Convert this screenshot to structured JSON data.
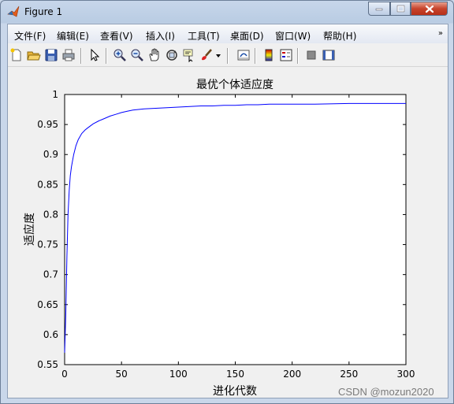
{
  "window": {
    "title": "Figure 1"
  },
  "menu": [
    "文件(F)",
    "编辑(E)",
    "查看(V)",
    "插入(I)",
    "工具(T)",
    "桌面(D)",
    "窗口(W)",
    "帮助(H)"
  ],
  "menu_overflow": "»",
  "toolbar": {
    "icons": [
      "new-figure-icon",
      "open-file-icon",
      "save-icon",
      "print-icon",
      "pointer-icon",
      "zoom-in-icon",
      "zoom-out-icon",
      "pan-icon",
      "rotate-3d-icon",
      "data-cursor-icon",
      "brush-icon",
      "brush-dropdown-icon",
      "link-plot-icon",
      "colorbar-icon",
      "legend-icon",
      "hide-plot-tools-icon",
      "show-plot-tools-icon"
    ]
  },
  "chart_data": {
    "type": "line",
    "title": "最优个体适应度",
    "xlabel": "进化代数",
    "ylabel": "适应度",
    "xlim": [
      0,
      300
    ],
    "ylim": [
      0.55,
      1
    ],
    "xticks": [
      "0",
      "50",
      "100",
      "150",
      "200",
      "250",
      "300"
    ],
    "yticks": [
      "0.55",
      "0.6",
      "0.65",
      "0.7",
      "0.75",
      "0.8",
      "0.85",
      "0.9",
      "0.95",
      "1"
    ],
    "grid": false,
    "series": [
      {
        "color": "#0000ff",
        "x": [
          0,
          1,
          2,
          3,
          4,
          5,
          6,
          8,
          10,
          12,
          15,
          18,
          20,
          25,
          30,
          35,
          40,
          45,
          50,
          55,
          60,
          70,
          80,
          90,
          100,
          110,
          120,
          130,
          140,
          150,
          160,
          170,
          180,
          200,
          220,
          250,
          280,
          300
        ],
        "y": [
          0.57,
          0.63,
          0.73,
          0.8,
          0.84,
          0.865,
          0.88,
          0.9,
          0.915,
          0.925,
          0.935,
          0.941,
          0.944,
          0.951,
          0.956,
          0.96,
          0.964,
          0.967,
          0.97,
          0.972,
          0.974,
          0.976,
          0.977,
          0.978,
          0.979,
          0.98,
          0.981,
          0.981,
          0.982,
          0.982,
          0.983,
          0.983,
          0.984,
          0.984,
          0.984,
          0.985,
          0.985,
          0.985
        ]
      }
    ]
  },
  "watermark": "CSDN @mozun2020"
}
